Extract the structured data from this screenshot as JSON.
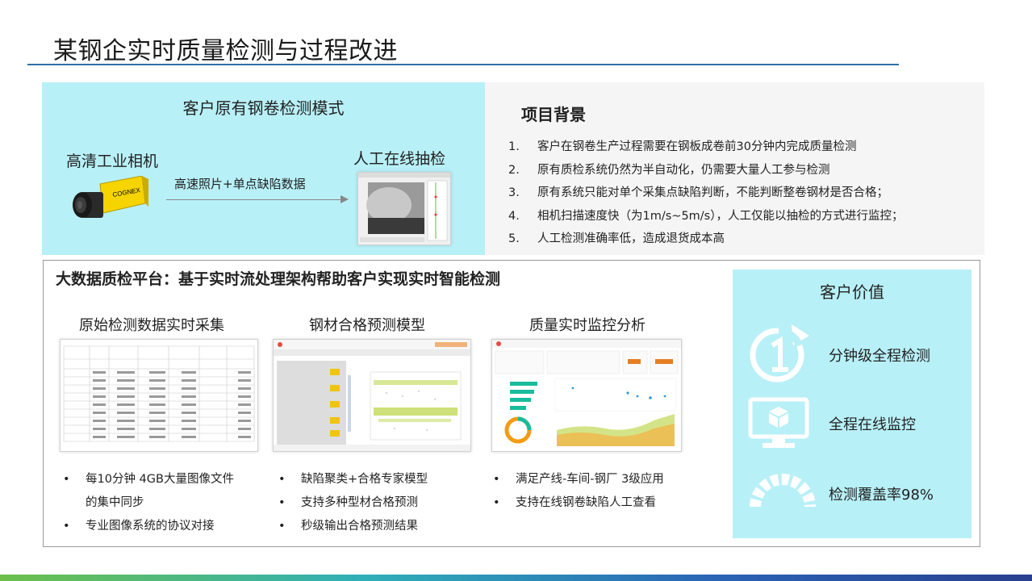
{
  "title": "某钢企实时质量检测与过程改进",
  "original_mode": {
    "title": "客户原有钢卷检测模式",
    "camera_label": "高清工业相机",
    "camera_brand": "COGNEX",
    "arrow_label": "高速照片+单点缺陷数据",
    "inspection_label": "人工在线抽检"
  },
  "background": {
    "title": "项目背景",
    "items": [
      {
        "num": "1.",
        "text": "客户在钢卷生产过程需要在钢板成卷前30分钟内完成质量检测"
      },
      {
        "num": "2.",
        "text": "原有质检系统仍然为半自动化，仍需要大量人工参与检测"
      },
      {
        "num": "3.",
        "text": "原有系统只能对单个采集点缺陷判断，不能判断整卷钢材是否合格；"
      },
      {
        "num": "4.",
        "text": "相机扫描速度快（为1m/s~5m/s），人工仅能以抽检的方式进行监控；"
      },
      {
        "num": "5.",
        "text": "人工检测准确率低，造成退货成本高"
      }
    ]
  },
  "platform": {
    "title": "大数据质检平台：基于实时流处理架构帮助客户实现实时智能检测",
    "columns": [
      {
        "title": "原始检测数据实时采集",
        "bullets": [
          {
            "dot": "•",
            "text": "每10分钟 4GB大量图像文件"
          },
          {
            "dot": "",
            "text": "的集中同步"
          },
          {
            "dot": "•",
            "text": "专业图像系统的协议对接"
          }
        ]
      },
      {
        "title": "钢材合格预测模型",
        "bullets": [
          {
            "dot": "•",
            "text": "缺陷聚类+合格专家模型"
          },
          {
            "dot": "•",
            "text": "支持多种型材合格预测"
          },
          {
            "dot": "•",
            "text": "秒级输出合格预测结果"
          }
        ]
      },
      {
        "title": "质量实时监控分析",
        "bullets": [
          {
            "dot": "•",
            "text": "满足产线-车间-钢厂 3级应用"
          },
          {
            "dot": "•",
            "text": "支持在线钢卷缺陷人工查看"
          }
        ]
      }
    ]
  },
  "customer_value": {
    "title": "客户价值",
    "items": [
      {
        "icon": "one-minute-cycle-icon",
        "text": "分钟级全程检测"
      },
      {
        "icon": "monitor-cube-icon",
        "text": "全程在线监控"
      },
      {
        "icon": "coverage-gauge-icon",
        "text": "检测覆盖率98%"
      }
    ]
  },
  "colors": {
    "accent_cyan": "#b8f0f7",
    "rule_blue": "#2f6fa8",
    "camera_yellow": "#f5d400"
  }
}
